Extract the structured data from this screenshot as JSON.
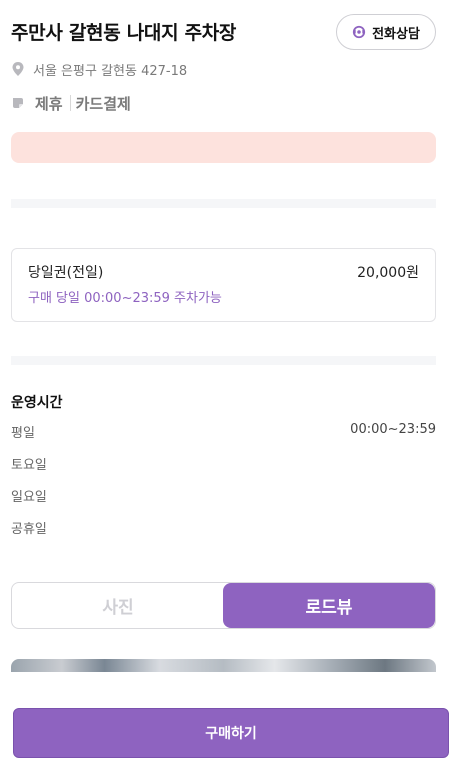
{
  "header": {
    "title": "주만사 갈현동 나대지 주차장",
    "call_button": {
      "label": "전화상담",
      "icon": "headset-icon"
    }
  },
  "address": {
    "text": "서울 은평구 갈현동 427-18",
    "icon": "location-pin-icon"
  },
  "tags": {
    "icon": "tag-icon",
    "items": [
      "제휴",
      "카드결제"
    ]
  },
  "notice": {
    "color": "#fde2dd"
  },
  "ticket": {
    "name": "당일권(전일)",
    "price": "20,000원",
    "description": "구매 당일 00:00~23:59 주차가능",
    "accent_color": "#8e63c0"
  },
  "hours": {
    "title": "운영시간",
    "rows": [
      {
        "day": "평일",
        "time": "00:00~23:59"
      },
      {
        "day": "토요일",
        "time": ""
      },
      {
        "day": "일요일",
        "time": ""
      },
      {
        "day": "공휴일",
        "time": ""
      }
    ]
  },
  "media_tabs": {
    "items": [
      "사진",
      "로드뷰"
    ],
    "selected": "로드뷰"
  },
  "purchase": {
    "label": "구매하기"
  },
  "colors": {
    "brand": "#8e63c0",
    "notice_bg": "#fde2dd",
    "separator": "#f5f6f8"
  }
}
